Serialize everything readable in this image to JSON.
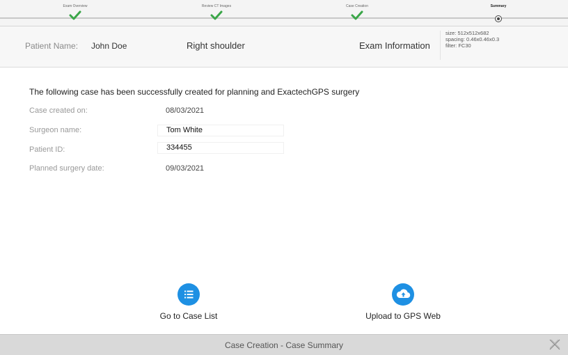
{
  "stepper": {
    "steps": [
      {
        "label": "Exam Overview",
        "state": "done"
      },
      {
        "label": "Review CT Images",
        "state": "done"
      },
      {
        "label": "Case Creation",
        "state": "done"
      },
      {
        "label": "Summary",
        "state": "current"
      }
    ],
    "done_color": "#3aa648"
  },
  "patient_bar": {
    "label": "Patient Name:",
    "name": "John Doe",
    "region": "Right shoulder",
    "exam_label": "Exam Information",
    "size": "size: 512x512x682",
    "spacing": "spacing: 0.46x0.46x0.3",
    "filter": "filter: FC30"
  },
  "summary": {
    "message": "The following case has been successfully created for planning and ExactechGPS surgery",
    "created_label": "Case created on:",
    "created_value": "08/03/2021",
    "surgeon_label": "Surgeon name:",
    "surgeon_value": "Tom White",
    "patient_id_label": "Patient ID:",
    "patient_id_value": "334455",
    "surgery_date_label": "Planned surgery date:",
    "surgery_date_value": "09/03/2021"
  },
  "actions": {
    "case_list": {
      "label": "Go to Case List",
      "icon": "list-icon"
    },
    "upload": {
      "label": "Upload to GPS Web",
      "icon": "cloud-upload-icon"
    },
    "accent": "#1e90e3"
  },
  "footer": {
    "title": "Case Creation - Case Summary",
    "close_icon": "close-icon"
  }
}
